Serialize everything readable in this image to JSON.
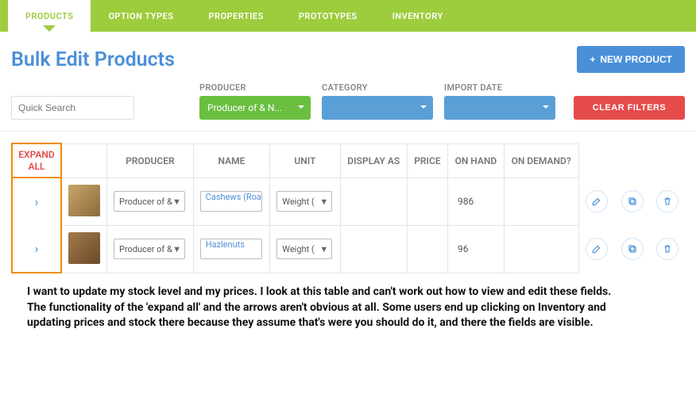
{
  "nav": {
    "tabs": [
      {
        "label": "PRODUCTS",
        "active": true
      },
      {
        "label": "OPTION TYPES",
        "active": false
      },
      {
        "label": "PROPERTIES",
        "active": false
      },
      {
        "label": "PROTOTYPES",
        "active": false
      },
      {
        "label": "INVENTORY",
        "active": false
      }
    ]
  },
  "page": {
    "title": "Bulk Edit Products",
    "new_button": "NEW PRODUCT"
  },
  "filters": {
    "quick_search_placeholder": "Quick Search",
    "producer_label": "PRODUCER",
    "producer_value": "Producer of & N...",
    "category_label": "CATEGORY",
    "category_value": "",
    "import_label": "IMPORT DATE",
    "import_value": "",
    "clear_label": "CLEAR FILTERS"
  },
  "table": {
    "headers": {
      "expand": "EXPAND ALL",
      "producer": "PRODUCER",
      "name": "NAME",
      "unit": "UNIT",
      "display_as": "DISPLAY AS",
      "price": "PRICE",
      "on_hand": "ON HAND",
      "on_demand": "ON DEMAND?"
    },
    "rows": [
      {
        "producer": "Producer of &",
        "name": "Cashews (Roa",
        "unit": "Weight (",
        "display_as": "",
        "price": "",
        "on_hand": "986",
        "on_demand": ""
      },
      {
        "producer": "Producer of &",
        "name": "Hazlenuts",
        "unit": "Weight (",
        "display_as": "",
        "price": "",
        "on_hand": "96",
        "on_demand": ""
      }
    ]
  },
  "commentary": {
    "p1": "I want to update my stock level and my prices. I look at this table and can't work out how to view and edit these fields.",
    "p2": "The functionality of the 'expand all' and the arrows aren't obvious at all. Some users end up clicking on Inventory and updating prices and stock there because they assume that's were you should do it, and there the fields are visible."
  }
}
